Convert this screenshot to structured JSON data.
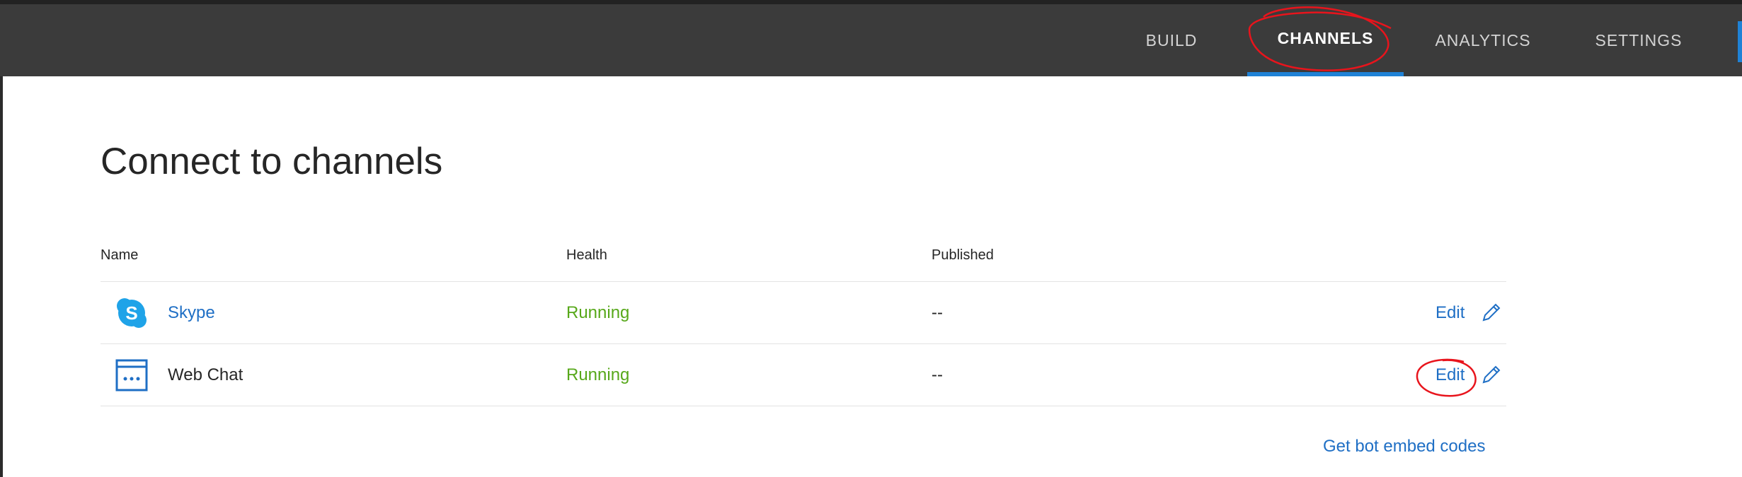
{
  "nav": {
    "tabs": [
      {
        "label": "BUILD",
        "active": false
      },
      {
        "label": "CHANNELS",
        "active": true
      },
      {
        "label": "ANALYTICS",
        "active": false
      },
      {
        "label": "SETTINGS",
        "active": false
      }
    ]
  },
  "page": {
    "title": "Connect to channels"
  },
  "table": {
    "headers": {
      "name": "Name",
      "health": "Health",
      "published": "Published"
    },
    "rows": [
      {
        "icon": "skype-icon",
        "name": "Skype",
        "health": "Running",
        "published": "--",
        "edit_label": "Edit"
      },
      {
        "icon": "web-chat-icon",
        "name": "Web Chat",
        "health": "Running",
        "published": "--",
        "edit_label": "Edit"
      }
    ]
  },
  "footer": {
    "embed_link": "Get bot embed codes"
  },
  "colors": {
    "topbar": "#3b3b3b",
    "accent": "#1f82d6",
    "link": "#1f6fc5",
    "health_ok": "#57a81a",
    "annotation": "#e8141c"
  }
}
